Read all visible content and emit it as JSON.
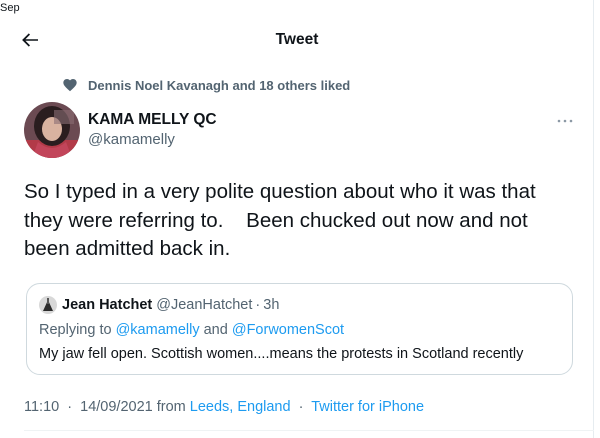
{
  "corner_label": "Sep",
  "header": {
    "title": "Tweet",
    "back_icon": "arrow-left-icon"
  },
  "social_context": {
    "icon": "heart-icon",
    "text": "Dennis Noel Kavanagh and 18 others liked"
  },
  "author": {
    "name": "KAMA MELLY QC",
    "handle": "@kamamelly",
    "more_icon": "more-dots-icon"
  },
  "tweet": {
    "text": "So I typed in a very polite question about who it was that\nthey were referring to.    Been chucked out now and not\nbeen admitted back in."
  },
  "quote": {
    "name": "Jean Hatchet",
    "handle": "@JeanHatchet",
    "separator": "·",
    "time": "3h",
    "replying_prefix": "Replying to",
    "replying_to_1": "@kamamelly",
    "replying_and": " and ",
    "replying_to_2": "@ForwomenScot",
    "text": "My jaw fell open. Scottish women....means the protests in Scotland recently"
  },
  "meta": {
    "time": "11:10",
    "separator": "·",
    "date": "14/09/2021",
    "from": "from",
    "location": "Leeds, England",
    "source": "Twitter for iPhone"
  },
  "colors": {
    "link": "#1d9bf0",
    "secondary": "#536471",
    "border": "#cfd9de",
    "text": "#0f1419"
  }
}
